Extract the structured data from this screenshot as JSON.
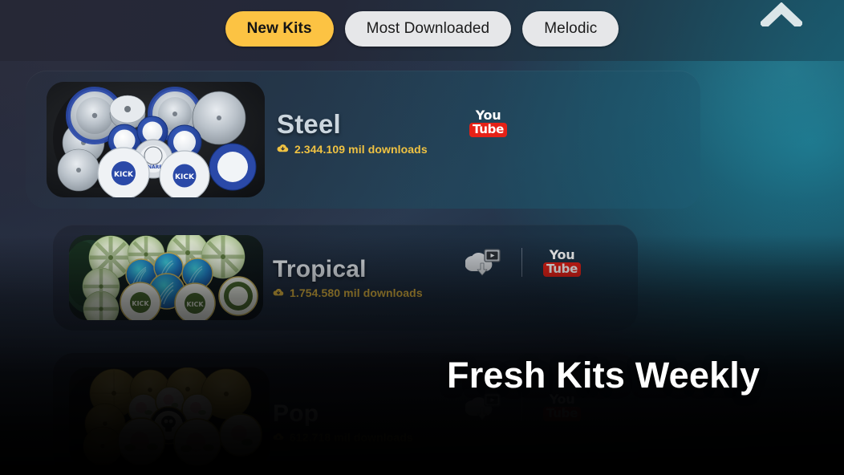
{
  "app": {
    "overlay_title": "Fresh Kits Weekly"
  },
  "topbar": {
    "scroll_up_icon": "chevron-up-icon",
    "tabs": [
      {
        "label": "New Kits",
        "active": true,
        "accent": "#fcc343"
      },
      {
        "label": "Most Downloaded",
        "active": false,
        "accent": "#e6e7e9"
      },
      {
        "label": "Melodic",
        "active": false,
        "accent": "#e6e7e9"
      }
    ]
  },
  "kits": [
    {
      "name": "Steel",
      "downloads": "2.344.109 mil downloads",
      "download_icon": "cloud-download-icon",
      "theme": "steel",
      "has_download_video": false,
      "has_divider": false,
      "youtube_label_top": "You",
      "youtube_label_bottom": "Tube",
      "dimmed": false
    },
    {
      "name": "Tropical",
      "downloads": "1.754.580 mil downloads",
      "download_icon": "cloud-download-icon",
      "theme": "tropical",
      "has_download_video": true,
      "has_divider": true,
      "youtube_label_top": "You",
      "youtube_label_bottom": "Tube",
      "dimmed": false
    },
    {
      "name": "Pop",
      "downloads": "612.718 mil downloads",
      "download_icon": "cloud-download-icon",
      "theme": "pop",
      "has_download_video": true,
      "has_divider": true,
      "youtube_label_top": "You",
      "youtube_label_bottom": "Tube",
      "dimmed": true
    }
  ],
  "colors": {
    "accent_amber": "#fcc343",
    "download_text": "#f0c242",
    "youtube_red": "#e62117",
    "background_dark": "#141a26",
    "background_teal": "#1a788e"
  }
}
